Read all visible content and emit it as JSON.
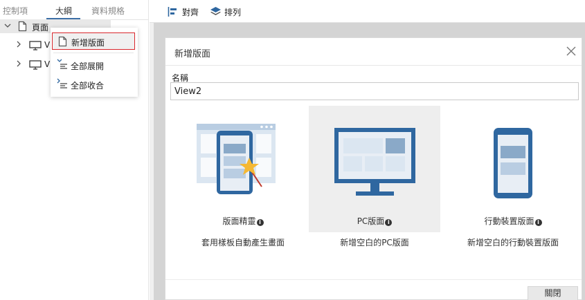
{
  "left_tabs": [
    {
      "label": "控制項"
    },
    {
      "label": "大綱"
    },
    {
      "label": "資料規格"
    }
  ],
  "tree": {
    "root_label": "頁面",
    "child1_label": "V",
    "child2_label": "V"
  },
  "context_menu": {
    "items": [
      {
        "label": "新增版面"
      },
      {
        "label": "全部展開"
      },
      {
        "label": "全部收合"
      }
    ]
  },
  "toolbar": {
    "align_label": "對齊",
    "arrange_label": "排列"
  },
  "dialog": {
    "title": "新增版面",
    "name_label": "名稱",
    "name_value": "View2",
    "options": [
      {
        "title": "版面精靈",
        "description": "套用樣板自動產生畫面"
      },
      {
        "title": "PC版面",
        "description": "新增空白的PC版面"
      },
      {
        "title": "行動裝置版面",
        "description": "新增空白的行動裝置版面"
      }
    ],
    "close_label": "關閉"
  },
  "colors": {
    "accent": "#3b6ea5",
    "illustration_blue": "#2f67a0",
    "illustration_light": "#dbe6f1",
    "star": "#f5b833",
    "selected_bg": "#eeeeee",
    "context_border": "#d9262c"
  }
}
